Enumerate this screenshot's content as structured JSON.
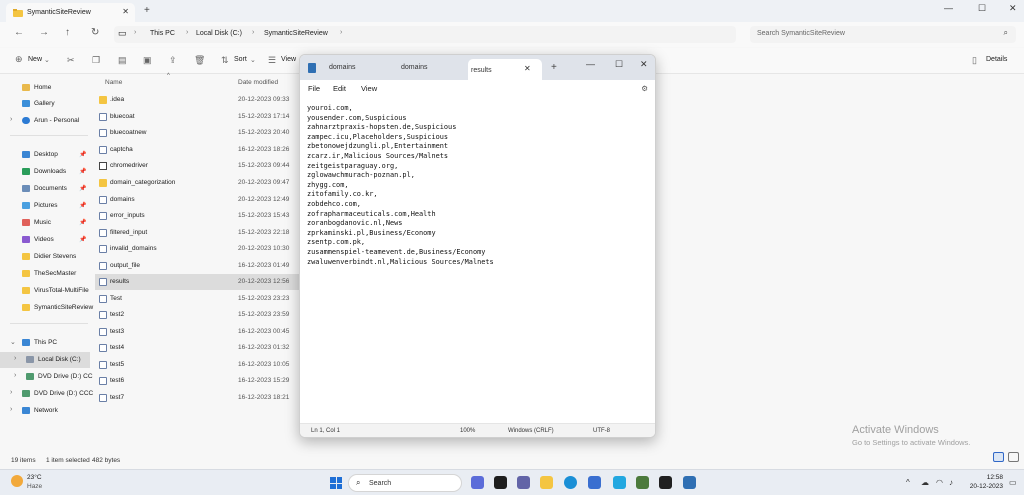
{
  "explorer": {
    "tab_title": "SymanticSiteReview",
    "breadcrumbs": [
      "This PC",
      "Local Disk (C:)",
      "SymanticSiteReview"
    ],
    "search_placeholder": "Search SymanticSiteReview",
    "toolbar": {
      "new_label": "New",
      "sort_label": "Sort",
      "view_label": "View",
      "details_label": "Details"
    },
    "columns": {
      "name": "Name",
      "date_modified": "Date modified"
    },
    "sidebar": {
      "home": "Home",
      "gallery": "Gallery",
      "onedrive": "Arun - Personal",
      "desktop": "Desktop",
      "downloads": "Downloads",
      "documents": "Documents",
      "pictures": "Pictures",
      "music": "Music",
      "videos": "Videos",
      "didier": "Didier Stevens",
      "thesecmaster": "TheSecMaster",
      "virustotal": "VirusTotal-MultiFile",
      "symantic": "SymanticSiteReview",
      "thispc": "This PC",
      "localdisk": "Local Disk (C:)",
      "dvd1": "DVD Drive (D:) CC",
      "dvd2": "DVD Drive (D:) CCC",
      "network": "Network"
    },
    "files": [
      {
        "name": ".idea",
        "date": "20-12-2023 09:33"
      },
      {
        "name": "bluecoat",
        "date": "15-12-2023 17:14"
      },
      {
        "name": "bluecoatnew",
        "date": "15-12-2023 20:40"
      },
      {
        "name": "captcha",
        "date": "16-12-2023 18:26"
      },
      {
        "name": "chromedriver",
        "date": "15-12-2023 09:44"
      },
      {
        "name": "domain_categorization",
        "date": "20-12-2023 09:47"
      },
      {
        "name": "domains",
        "date": "20-12-2023 12:49"
      },
      {
        "name": "error_inputs",
        "date": "15-12-2023 15:43"
      },
      {
        "name": "filtered_input",
        "date": "15-12-2023 22:18"
      },
      {
        "name": "invalid_domains",
        "date": "20-12-2023 10:30"
      },
      {
        "name": "output_file",
        "date": "16-12-2023 01:49"
      },
      {
        "name": "results",
        "date": "20-12-2023 12:56"
      },
      {
        "name": "Test",
        "date": "15-12-2023 23:23"
      },
      {
        "name": "test2",
        "date": "15-12-2023 23:59"
      },
      {
        "name": "test3",
        "date": "16-12-2023 00:45"
      },
      {
        "name": "test4",
        "date": "16-12-2023 01:32"
      },
      {
        "name": "test5",
        "date": "16-12-2023 10:05"
      },
      {
        "name": "test6",
        "date": "16-12-2023 15:29"
      },
      {
        "name": "test7",
        "date": "16-12-2023 18:21"
      }
    ],
    "status": {
      "items": "19 items",
      "selected": "1 item selected",
      "size": "482 bytes"
    }
  },
  "notepad": {
    "tabs": [
      "domains",
      "domains",
      "results"
    ],
    "menu": [
      "File",
      "Edit",
      "View"
    ],
    "content": "youroi.com,\nyousender.com,Suspicious\nzahnarztpraxis-hopsten.de,Suspicious\nzampec.icu,Placeholders,Suspicious\nzbetonowejdzungli.pl,Entertainment\nzcarz.ir,Malicious Sources/Malnets\nzeitgeistparaguay.org,\nzglowawchmurach-poznan.pl,\nzhygg.com,\nzitofamily.co.kr,\nzobdehco.com,\nzofrapharmaceuticals.com,Health\nzoranbogdanovic.nl,News\nzprkaminski.pl,Business/Economy\nzsentp.com.pk,\nzusammenspiel-teamevent.de,Business/Economy\nzwaluwenverbindt.nl,Malicious Sources/Malnets",
    "status": {
      "position": "Ln 1, Col 1",
      "zoom": "100%",
      "line_ending": "Windows (CRLF)",
      "encoding": "UTF-8"
    }
  },
  "watermark": {
    "line1": "Activate Windows",
    "line2": "Go to Settings to activate Windows."
  },
  "taskbar": {
    "temperature": "23°C",
    "condition": "Haze",
    "search_label": "Search",
    "time": "12:58",
    "date": "20-12-2023"
  }
}
